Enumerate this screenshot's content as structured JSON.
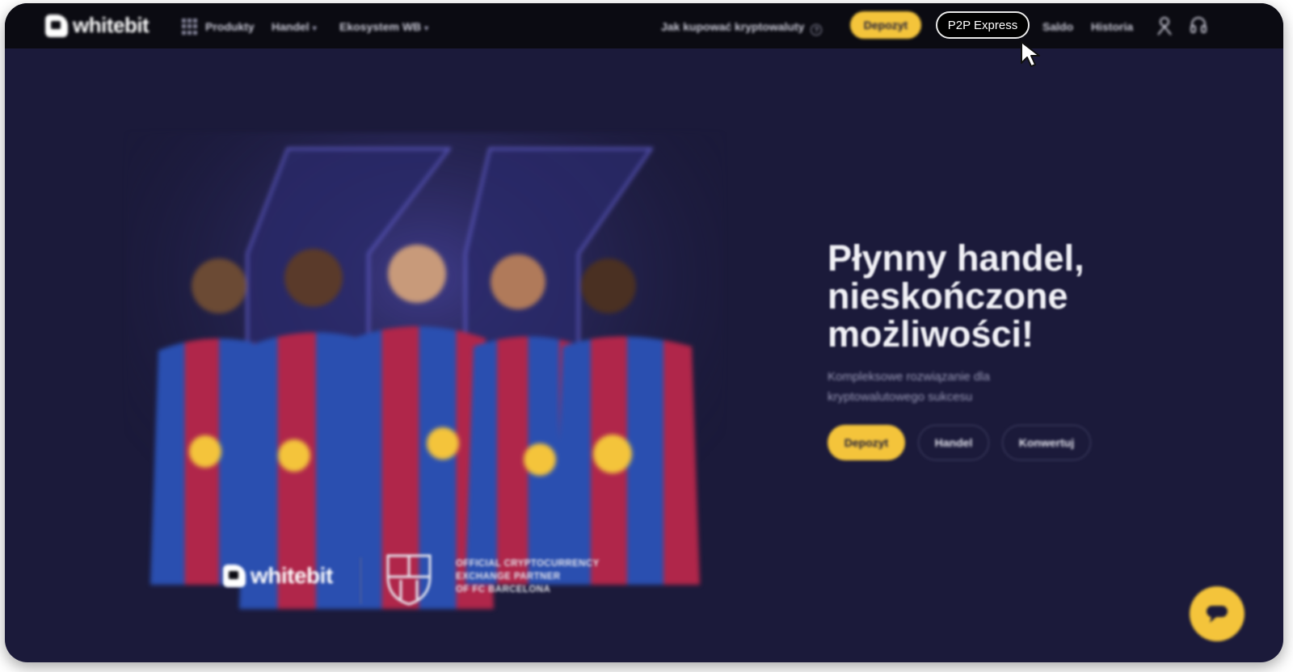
{
  "nav": {
    "logo_text": "whitebit",
    "products": "Produkty",
    "trade": "Handel",
    "ecosystem": "Ekosystem WB",
    "how_to_buy": "Jak kupować kryptowaluty",
    "deposit": "Depozyt",
    "p2p_express": "P2P Express",
    "balance": "Saldo",
    "history": "Historia"
  },
  "hero": {
    "title_lines": [
      "Płynny handel,",
      "nieskończone",
      "możliwości!"
    ],
    "subtitle": "Kompleksowe rozwiązanie dla kryptowalutowego sukcesu",
    "buttons": {
      "deposit": "Depozyt",
      "trade": "Handel",
      "convert": "Konwertuj"
    }
  },
  "partner": {
    "logo_text": "whitebit",
    "line1": "OFFICIAL CRYPTOCURRENCY",
    "line2": "EXCHANGE PARTNER",
    "line3": "OF FC BARCELONA"
  },
  "colors": {
    "background": "#1b1a3a",
    "nav": "#0b0b12",
    "accent": "#f4c43b",
    "jersey_blue": "#2a4fb0",
    "jersey_red": "#b0264a"
  },
  "icons": [
    "grid-icon",
    "chevron-down-icon",
    "help-icon",
    "user-icon",
    "headset-icon",
    "cursor-icon",
    "chat-icon"
  ]
}
